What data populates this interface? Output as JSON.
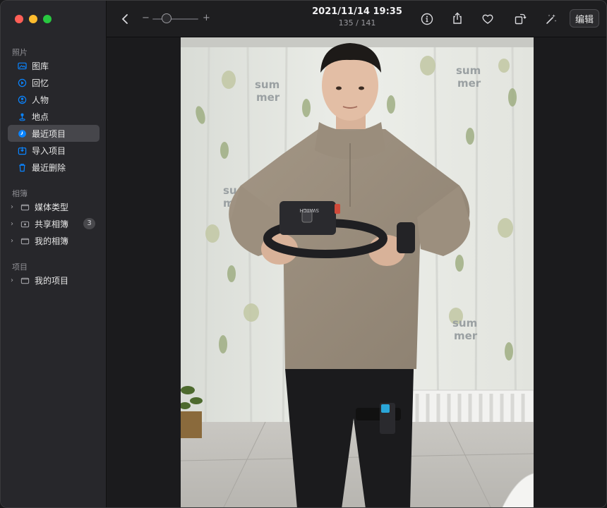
{
  "sidebar": {
    "sections": {
      "photos": "照片",
      "albums": "相簿",
      "projects": "项目"
    },
    "photo_items": [
      {
        "label": "图库",
        "icon": "library-icon"
      },
      {
        "label": "回忆",
        "icon": "memories-icon"
      },
      {
        "label": "人物",
        "icon": "people-icon"
      },
      {
        "label": "地点",
        "icon": "places-icon"
      },
      {
        "label": "最近项目",
        "icon": "recents-icon",
        "active": true
      },
      {
        "label": "导入项目",
        "icon": "imports-icon"
      },
      {
        "label": "最近删除",
        "icon": "trash-icon"
      }
    ],
    "album_items": [
      {
        "label": "媒体类型"
      },
      {
        "label": "共享相簿",
        "badge": "3"
      },
      {
        "label": "我的相簿"
      }
    ],
    "project_items": [
      {
        "label": "我的项目"
      }
    ]
  },
  "toolbar": {
    "date": "2021/11/14 19:35",
    "count": "135 / 141",
    "zoom_minus": "−",
    "zoom_plus": "+",
    "zoom_level": 0.3,
    "edit_label": "编辑"
  },
  "colors": {
    "accent": "#0a84ff",
    "close": "#ff5f57",
    "minimize": "#febc2e",
    "zoom": "#28c840"
  }
}
